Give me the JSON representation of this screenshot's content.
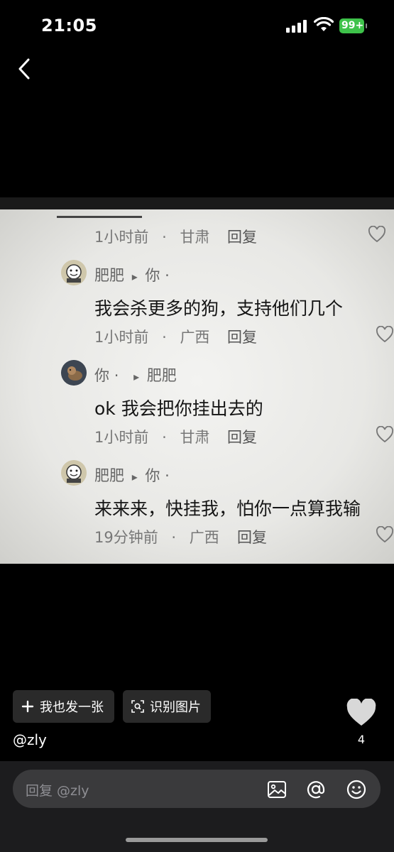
{
  "status_bar": {
    "time": "21:05",
    "battery": "99+"
  },
  "image": {
    "comments": [
      {
        "type": "meta",
        "time": "1小时前",
        "dot": "·",
        "region": "甘肃",
        "reply": "回复"
      },
      {
        "type": "comment",
        "author": "肥肥",
        "arrow": "▸",
        "target": "你",
        "suffix": "·",
        "text": "我会杀更多的狗，支持他们几个",
        "time": "1小时前",
        "dot": "·",
        "region": "广西",
        "reply": "回复"
      },
      {
        "type": "comment",
        "author": "你",
        "prefix": "·",
        "arrow": "▸",
        "target": "肥肥",
        "text": "ok 我会把你挂出去的",
        "time": "1小时前",
        "dot": "·",
        "region": "甘肃",
        "reply": "回复"
      },
      {
        "type": "comment",
        "author": "肥肥",
        "arrow": "▸",
        "target": "你",
        "suffix": "·",
        "text": "来来来，快挂我，怕你一点算我输",
        "time": "19分钟前",
        "dot": "·",
        "region": "广西",
        "reply": "回复"
      }
    ]
  },
  "actions": {
    "post_label": "我也发一张",
    "recognize_label": "识别图片"
  },
  "post": {
    "username": "@zly",
    "like_count": "4"
  },
  "reply_bar": {
    "placeholder": "回复 @zly"
  },
  "icons": [
    "back-icon",
    "plus-icon",
    "scan-icon",
    "heart-icon",
    "image-icon",
    "at-icon",
    "emoji-icon"
  ]
}
